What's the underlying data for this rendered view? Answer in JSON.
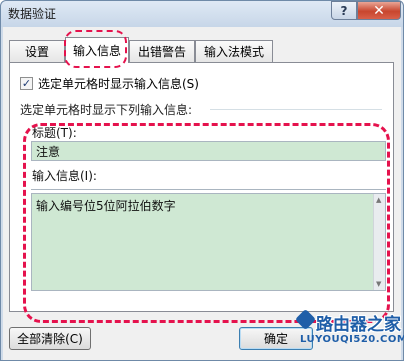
{
  "window": {
    "title": "数据验证",
    "help_label": "?",
    "close_label": "✕"
  },
  "tabs": [
    {
      "label": "设置",
      "active": false
    },
    {
      "label": "输入信息",
      "active": true
    },
    {
      "label": "出错警告",
      "active": false
    },
    {
      "label": "输入法模式",
      "active": false
    }
  ],
  "input_message": {
    "show_checkbox_label": "选定单元格时显示输入信息(S)",
    "show_checkbox_checked": true,
    "group_label": "选定单元格时显示下列输入信息:",
    "title_label": "标题(T):",
    "title_value": "注意",
    "message_label": "输入信息(I):",
    "message_value": "输入编号位5位阿拉伯数字"
  },
  "buttons": {
    "clear_all": "全部清除(C)",
    "ok": "确定"
  },
  "watermark": {
    "main": "路由器之家",
    "sub": "LUYOUQI520.COM"
  },
  "colors": {
    "highlight_outline": "#e5124d",
    "field_fill": "#cfe8d3",
    "titlebar": "#cfdbe9",
    "watermark": "#1f5ea8"
  }
}
